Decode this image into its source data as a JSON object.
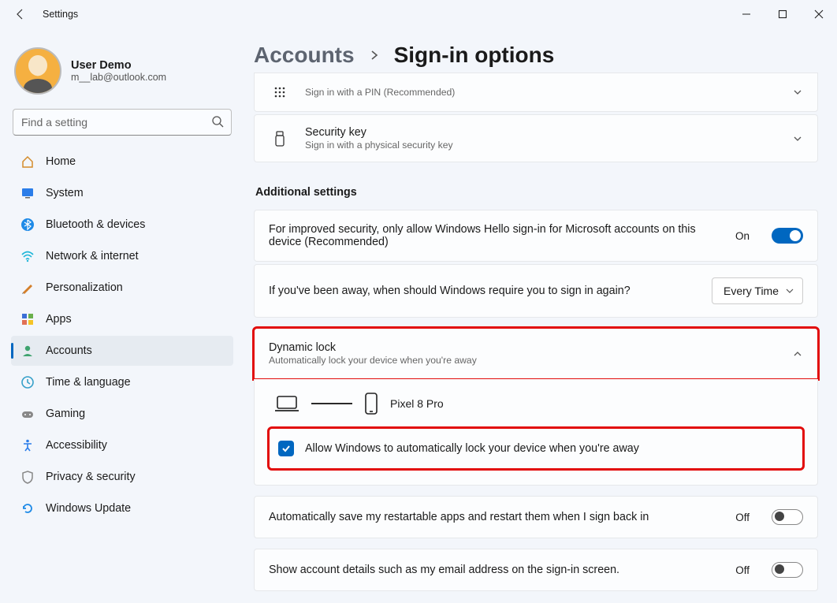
{
  "window": {
    "title": "Settings"
  },
  "profile": {
    "name": "User Demo",
    "email": "m__lab@outlook.com"
  },
  "search": {
    "placeholder": "Find a setting"
  },
  "nav": {
    "home": "Home",
    "system": "System",
    "bluetooth": "Bluetooth & devices",
    "network": "Network & internet",
    "personalization": "Personalization",
    "apps": "Apps",
    "accounts": "Accounts",
    "time": "Time & language",
    "gaming": "Gaming",
    "accessibility": "Accessibility",
    "privacy": "Privacy & security",
    "update": "Windows Update"
  },
  "breadcrumb": {
    "parent": "Accounts",
    "current": "Sign-in options"
  },
  "signin_methods": {
    "pin_sub": "Sign in with a PIN (Recommended)",
    "seckey_title": "Security key",
    "seckey_sub": "Sign in with a physical security key"
  },
  "additional": {
    "heading": "Additional settings",
    "hello_only_text": "For improved security, only allow Windows Hello sign-in for Microsoft accounts on this device (Recommended)",
    "hello_only_state": "On",
    "away_text": "If you've been away, when should Windows require you to sign in again?",
    "away_value": "Every Time",
    "dynlock_title": "Dynamic lock",
    "dynlock_sub": "Automatically lock your device when you're away",
    "paired_device": "Pixel 8 Pro",
    "dynlock_check_label": "Allow Windows to automatically lock your device when you're away",
    "restart_apps_text": "Automatically save my restartable apps and restart them when I sign back in",
    "restart_apps_state": "Off",
    "show_email_text": "Show account details such as my email address on the sign-in screen.",
    "show_email_state": "Off"
  }
}
